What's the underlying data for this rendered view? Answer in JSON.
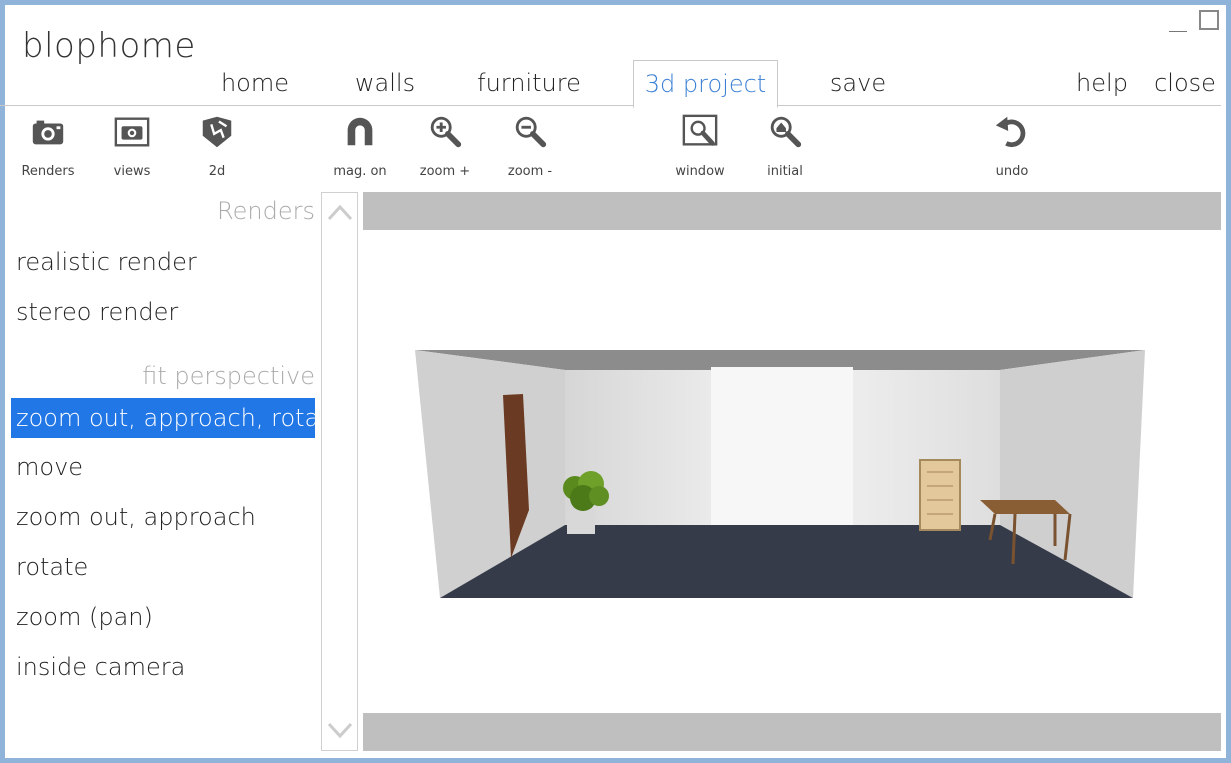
{
  "app": {
    "title": "blophome"
  },
  "tabs": [
    {
      "label": "home"
    },
    {
      "label": "walls"
    },
    {
      "label": "furniture"
    },
    {
      "label": "3d project"
    },
    {
      "label": "save"
    },
    {
      "label": "help"
    },
    {
      "label": "close"
    }
  ],
  "toolbar": {
    "renders": "Renders",
    "views": "views",
    "twod": "2d",
    "mag": "mag. on",
    "zoom_in": "zoom +",
    "zoom_out": "zoom -",
    "window": "window",
    "initial": "initial",
    "undo": "undo"
  },
  "left_panel": {
    "renders_heading": "Renders",
    "render_items": [
      "realistic render",
      "stereo render"
    ],
    "fit_heading": "fit perspective",
    "perspective_items": [
      "zoom out, approach, rotate",
      "move",
      "zoom out, approach",
      "rotate",
      "zoom (pan)",
      "inside camera"
    ],
    "selected_item": "zoom out, approach, rotate"
  },
  "colors": {
    "accent": "#3a7fd5",
    "selection": "#2277e6",
    "floor": "#353b48",
    "door": "#6b3a22",
    "table": "#8a5e34"
  }
}
